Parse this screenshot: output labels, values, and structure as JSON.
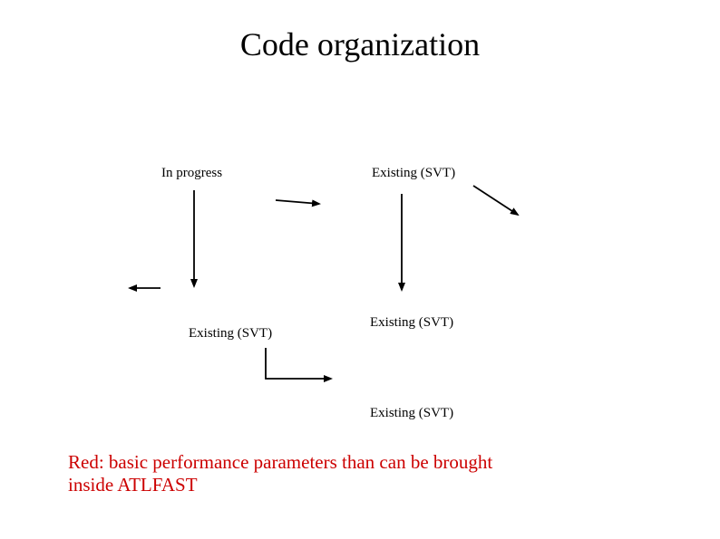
{
  "title": "Code organization",
  "labels": {
    "in_progress": "In progress",
    "existing_svt_1": "Existing (SVT)",
    "existing_svt_2": "Existing  (SVT)",
    "existing_svt_3": "Existing (SVT)",
    "existing_svt_4": "Existing (SVT)"
  },
  "footer": "Red: basic performance parameters than can be brought inside ATLFAST"
}
